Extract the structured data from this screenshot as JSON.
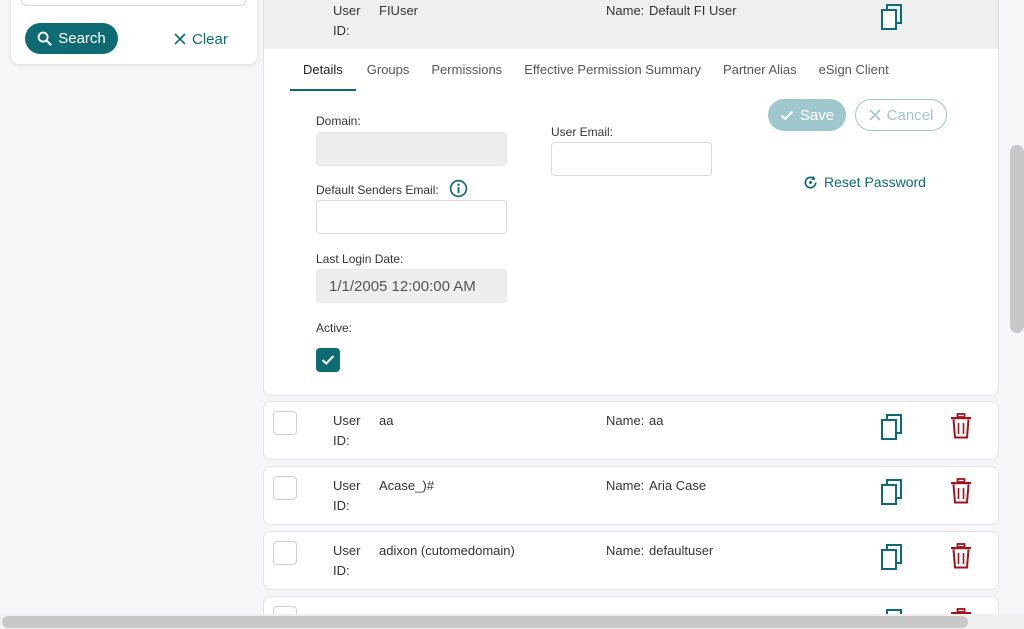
{
  "search_panel": {
    "search_label": "Search",
    "clear_label": "Clear"
  },
  "selected_user": {
    "user_id_label": "User ID:",
    "user_id": "FIUser",
    "name_label": "Name:",
    "name": "Default FI User"
  },
  "tabs": [
    {
      "label": "Details"
    },
    {
      "label": "Groups"
    },
    {
      "label": "Permissions"
    },
    {
      "label": "Effective Permission Summary"
    },
    {
      "label": "Partner Alias"
    },
    {
      "label": "eSign Client"
    }
  ],
  "details": {
    "domain_label": "Domain:",
    "domain_value": "",
    "user_email_label": "User Email:",
    "user_email_value": "",
    "default_senders_email_label": "Default Senders Email:",
    "default_senders_email_value": "",
    "last_login_date_label": "Last Login Date:",
    "last_login_date_value": "1/1/2005 12:00:00 AM",
    "active_label": "Active:",
    "active": true,
    "save_label": "Save",
    "cancel_label": "Cancel",
    "reset_password_label": "Reset Password"
  },
  "user_rows": [
    {
      "user_id_label": "User ID:",
      "user_id": "aa",
      "name_label": "Name:",
      "name": "aa"
    },
    {
      "user_id_label": "User ID:",
      "user_id": "Acase_)#",
      "name_label": "Name:",
      "name": "Aria Case"
    },
    {
      "user_id_label": "User ID:",
      "user_id": "adixon (cutomedomain)",
      "name_label": "Name:",
      "name": "defaultuser"
    }
  ],
  "colors": {
    "primary": "#0e6b73",
    "delete": "#a3141a",
    "disabled_primary": "#9ec8ce"
  }
}
